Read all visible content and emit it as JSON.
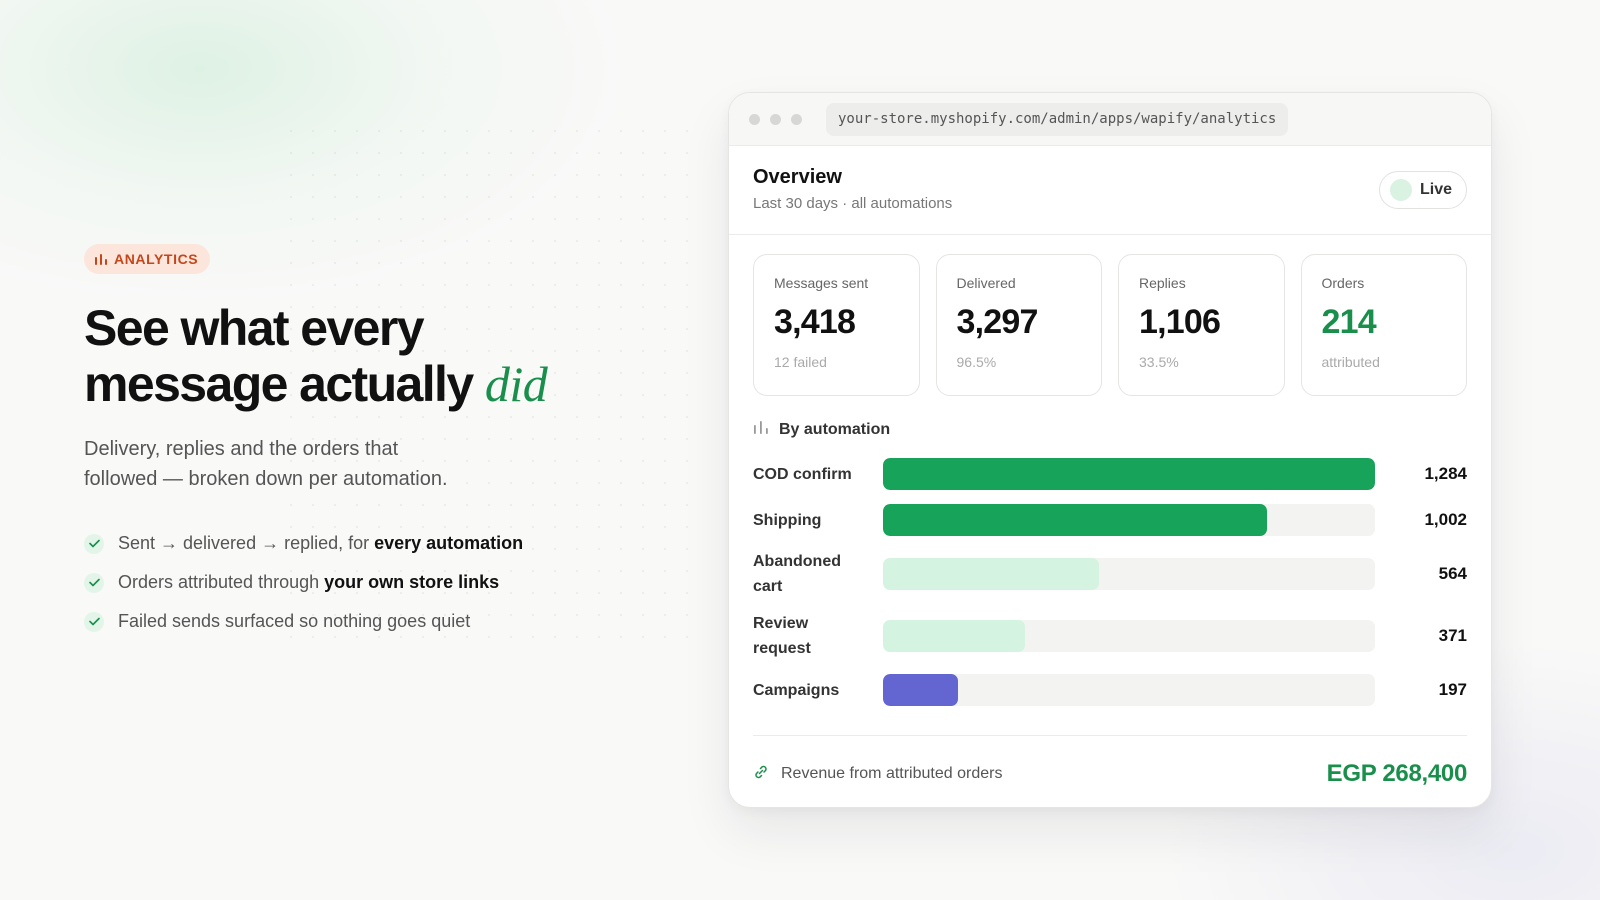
{
  "hero": {
    "badge": "ANALYTICS",
    "title_line1": "See what every",
    "title_line2": "message actually",
    "title_accent": "did",
    "lede": "Delivery, replies and the orders that followed — broken down per automation.",
    "checks": [
      {
        "text": "Sent → delivered → replied, for ",
        "bold": "every automation"
      },
      {
        "text": "Orders attributed through ",
        "bold": "your own store links"
      },
      {
        "text": "Failed sends surfaced so nothing goes quiet",
        "bold": ""
      }
    ]
  },
  "window": {
    "url": "your-store.myshopify.com/admin/apps/wapify/analytics",
    "overview_title": "Overview",
    "overview_sub": "Last 30 days · all automations",
    "live_label": "Live"
  },
  "stats": [
    {
      "label": "Messages sent",
      "value": "3,418",
      "note": "12 failed"
    },
    {
      "label": "Delivered",
      "value": "3,297",
      "note": "96.5%"
    },
    {
      "label": "Replies",
      "value": "1,106",
      "note": "33.5%"
    },
    {
      "label": "Orders",
      "value": "214",
      "note": "attributed"
    }
  ],
  "by_automation": {
    "title": "By automation",
    "max": 1284,
    "rows": [
      {
        "label": "COD confirm",
        "value": 1284,
        "display": "1,284",
        "color": "#17a35a"
      },
      {
        "label": "Shipping",
        "value": 1002,
        "display": "1,002",
        "color": "#17a35a"
      },
      {
        "label": "Abandoned cart",
        "value": 564,
        "display": "564",
        "color": "#d4f3e0"
      },
      {
        "label": "Review request",
        "value": 371,
        "display": "371",
        "color": "#d4f3e0"
      },
      {
        "label": "Campaigns",
        "value": 197,
        "display": "197",
        "color": "#6366d1"
      }
    ]
  },
  "revenue": {
    "label": "Revenue from attributed orders",
    "value": "EGP 268,400"
  },
  "colors": {
    "accent_green": "#1a8f4c",
    "badge_orange": "#c4471c"
  }
}
